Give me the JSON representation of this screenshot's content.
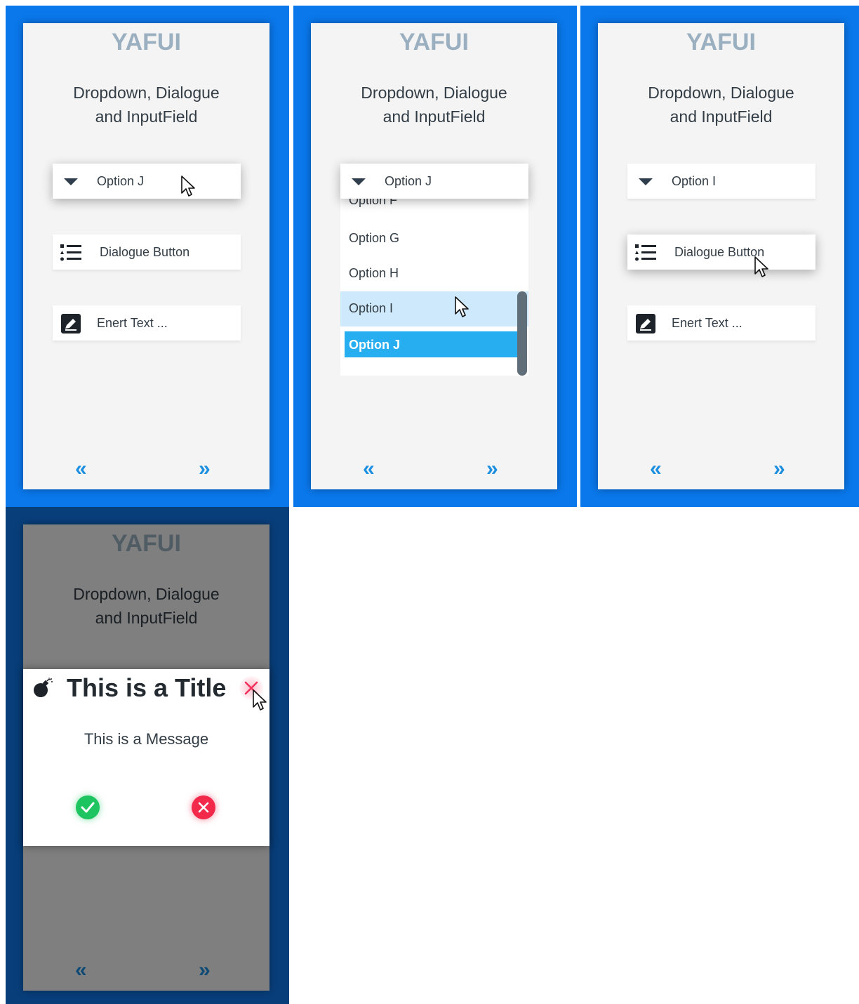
{
  "app": {
    "title": "YAFUI",
    "subtitle_line1": "Dropdown, Dialogue",
    "subtitle_line2": "and InputField",
    "nav_prev": "«",
    "nav_next": "»"
  },
  "frame1": {
    "dropdown_value": "Option J",
    "dialogue_button_label": "Dialogue Button",
    "input_placeholder": "Enert Text ..."
  },
  "frame2": {
    "dropdown_value": "Option J",
    "options": [
      {
        "label": "Option F"
      },
      {
        "label": "Option G"
      },
      {
        "label": "Option H"
      },
      {
        "label": "Option I"
      },
      {
        "label": "Option J"
      }
    ]
  },
  "frame3": {
    "dropdown_value": "Option I",
    "dialogue_button_label": "Dialogue Button",
    "input_placeholder": "Enert Text ..."
  },
  "frame4": {
    "dialog_title": "This is a Title",
    "dialog_message": "This is a Message"
  },
  "colors": {
    "frame_blue": "#0a77ea",
    "frame_dark_blue": "#083e7a",
    "title_gray": "#9ab0c0",
    "selected_option": "#26aef0",
    "hover_option": "#cde9fb",
    "confirm_green": "#1dc45f",
    "cancel_red": "#f2294b"
  },
  "icons": {
    "dropdown": "caret-down-icon",
    "dialogue": "list-icon",
    "input": "edit-icon",
    "dialog_title": "bomb-icon",
    "close": "close-icon",
    "confirm": "check-circle-icon",
    "cancel": "x-circle-icon",
    "prev": "double-chevron-left-icon",
    "next": "double-chevron-right-icon"
  }
}
